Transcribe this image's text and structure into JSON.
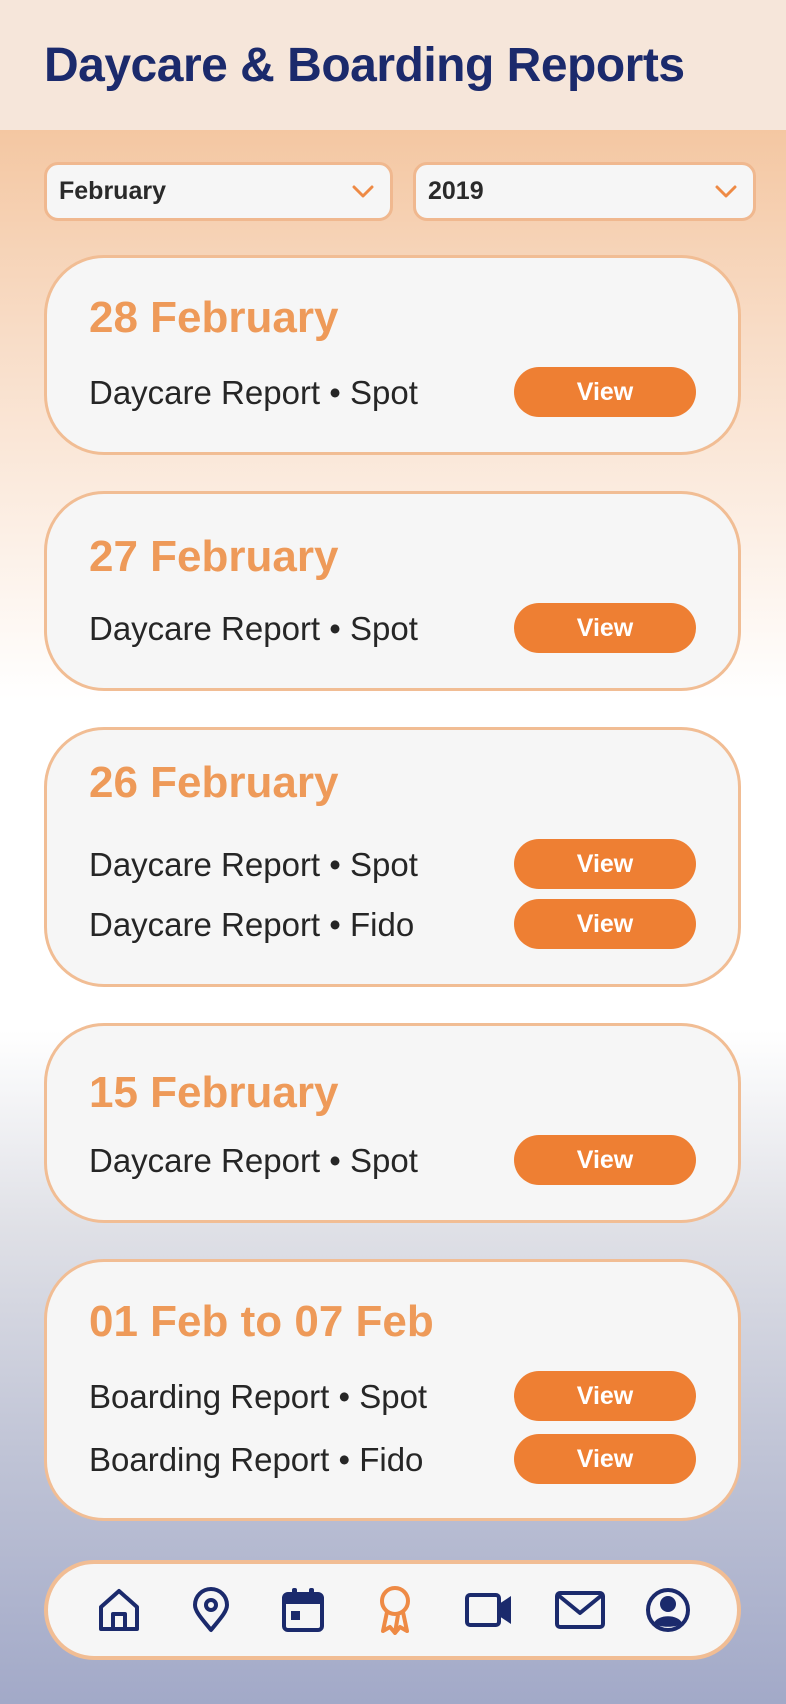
{
  "header": {
    "title": "Daycare & Boarding Reports"
  },
  "filters": {
    "month": {
      "value": "February"
    },
    "year": {
      "value": "2019"
    }
  },
  "report_groups": [
    {
      "date": "28 February",
      "reports": [
        {
          "label": "Daycare Report • Spot",
          "action": "View"
        }
      ]
    },
    {
      "date": "27 February",
      "reports": [
        {
          "label": "Daycare Report • Spot",
          "action": "View"
        }
      ]
    },
    {
      "date": "26 February",
      "reports": [
        {
          "label": "Daycare Report • Spot",
          "action": "View"
        },
        {
          "label": "Daycare Report • Fido",
          "action": "View"
        }
      ]
    },
    {
      "date": "15 February",
      "reports": [
        {
          "label": "Daycare Report • Spot",
          "action": "View"
        }
      ]
    },
    {
      "date": "01 Feb to 07 Feb",
      "reports": [
        {
          "label": "Boarding Report • Spot",
          "action": "View"
        },
        {
          "label": "Boarding Report • Fido",
          "action": "View"
        }
      ]
    }
  ],
  "bottom_nav": {
    "items": [
      "home-icon",
      "location-pin-icon",
      "calendar-icon",
      "award-ribbon-icon",
      "video-camera-icon",
      "mail-icon",
      "profile-icon"
    ],
    "active": "award-ribbon-icon"
  },
  "colors": {
    "title": "#1b2a6c",
    "accent": "#ee7f33",
    "date_text": "#ee9a59",
    "card_border": "#f1bd94",
    "nav_icon": "#1b2a6c"
  }
}
